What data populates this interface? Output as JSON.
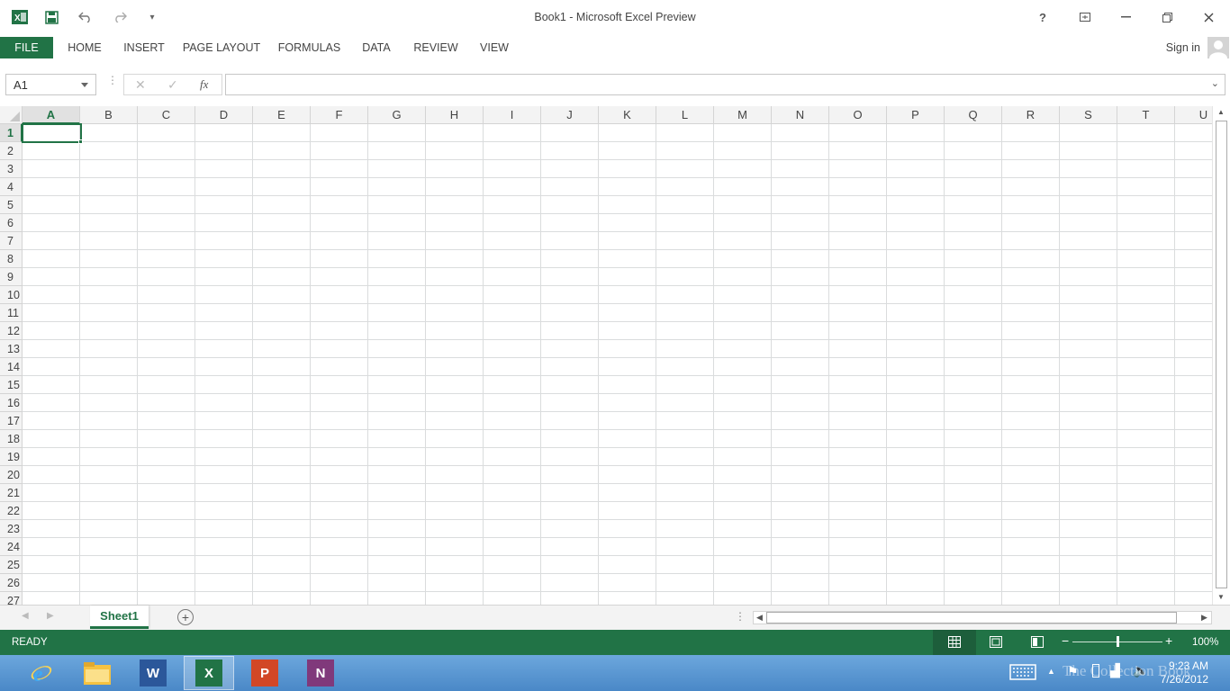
{
  "window": {
    "title": "Book1 - Microsoft Excel Preview",
    "help": "?"
  },
  "ribbon": {
    "tabs": [
      "FILE",
      "HOME",
      "INSERT",
      "PAGE LAYOUT",
      "FORMULAS",
      "DATA",
      "REVIEW",
      "VIEW"
    ],
    "sign_in": "Sign in"
  },
  "formula_bar": {
    "name_box": "A1",
    "fx_label": "fx",
    "formula": ""
  },
  "grid": {
    "columns": [
      "A",
      "B",
      "C",
      "D",
      "E",
      "F",
      "G",
      "H",
      "I",
      "J",
      "K",
      "L",
      "M",
      "N",
      "O",
      "P",
      "Q",
      "R",
      "S",
      "T",
      "U"
    ],
    "rows": [
      "1",
      "2",
      "3",
      "4",
      "5",
      "6",
      "7",
      "8",
      "9",
      "10",
      "11",
      "12",
      "13",
      "14",
      "15",
      "16",
      "17",
      "18",
      "19",
      "20",
      "21",
      "22",
      "23",
      "24",
      "25",
      "26",
      "27"
    ],
    "active_cell": "A1"
  },
  "sheets": {
    "tabs": [
      "Sheet1"
    ],
    "active": "Sheet1"
  },
  "status": {
    "mode": "READY",
    "zoom": "100%",
    "zoom_level": 1.0
  },
  "taskbar": {
    "apps": [
      "internet-explorer",
      "file-explorer",
      "word",
      "excel",
      "powerpoint",
      "onenote"
    ],
    "time": "9:23 AM",
    "date": "7/26/2012",
    "watermark": "The Collection Book"
  },
  "colors": {
    "excel_green": "#217346",
    "taskbar_blue": "#5b9bd5"
  }
}
